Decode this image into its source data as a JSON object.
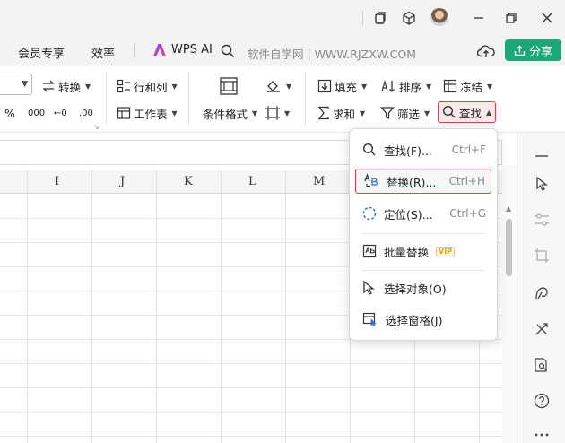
{
  "menu": {
    "items": [
      "会员专享",
      "效率"
    ],
    "wps_ai": "WPS AI",
    "search_hint": "软件自学网 | WWW.RJZXW.COM",
    "share": "分享"
  },
  "ribbon": {
    "convert": "转换",
    "rowcol": "行和列",
    "fill": "填充",
    "sort": "排序",
    "freeze": "冻结",
    "worksheet": "工作表",
    "cond_format": "条件格式",
    "sum": "求和",
    "filter": "筛选",
    "find": "查找",
    "percent": "%",
    "thousands": "000",
    "dec_inc": "←0",
    "dec_dec": ".00"
  },
  "columns": [
    "I",
    "J",
    "K",
    "L",
    "M"
  ],
  "dropdown": {
    "items": [
      {
        "icon": "search-icon",
        "label": "查找(F)...",
        "shortcut": "Ctrl+F"
      },
      {
        "icon": "replace-icon",
        "label": "替换(R)...",
        "shortcut": "Ctrl+H",
        "highlighted": true
      },
      {
        "icon": "goto-icon",
        "label": "定位(S)...",
        "shortcut": "Ctrl+G"
      },
      {
        "icon": "batch-replace-icon",
        "label": "批量替换",
        "badge": "VIP"
      },
      {
        "icon": "cursor-icon",
        "label": "选择对象(O)"
      },
      {
        "icon": "selection-pane-icon",
        "label": "选择窗格(J)"
      }
    ]
  },
  "colors": {
    "accent_green": "#1aa87a",
    "highlight_red": "#e0404a"
  }
}
